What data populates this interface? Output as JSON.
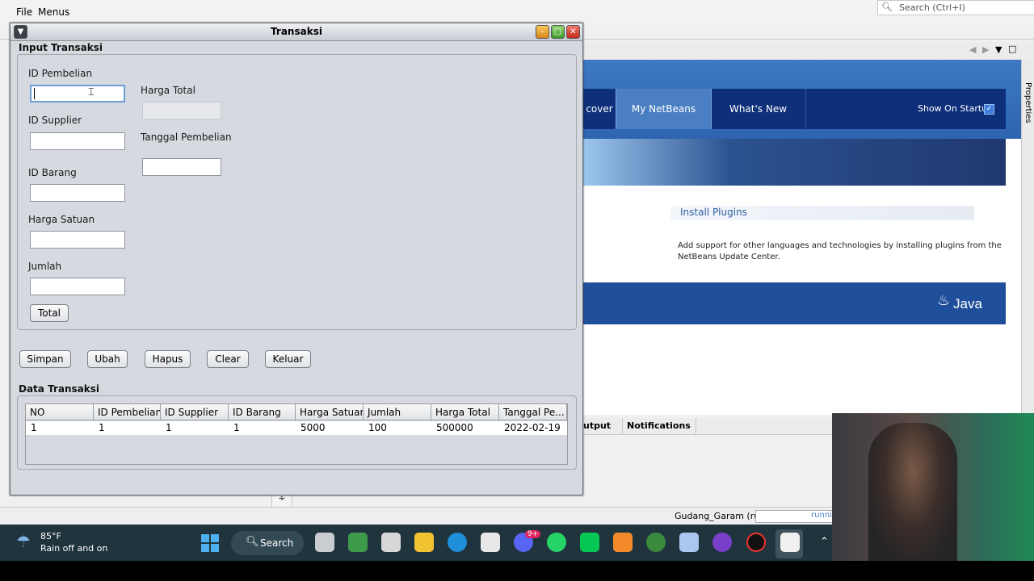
{
  "ide": {
    "menu": [
      "File",
      "Menus"
    ],
    "search_placeholder": "Search (Ctrl+I)",
    "status_text": "Gudang_Garam (run)",
    "status_progress": "runni",
    "side_tab": "Properties"
  },
  "start_page": {
    "tabs": [
      "cover",
      "My NetBeans",
      "What's New"
    ],
    "active_tab": "My NetBeans",
    "show_on_startup": "Show On Startup",
    "install_title": "Install Plugins",
    "install_desc_1": "Add support for other languages and technologies by installing plugins from the",
    "install_desc_2": "NetBeans Update Center.",
    "brand": "Java"
  },
  "output_panel": {
    "tabs": [
      "utput",
      "Notifications"
    ]
  },
  "dialog": {
    "title": "Transaksi",
    "input_section": "Input Transaksi",
    "fields": {
      "id_pembelian": {
        "label": "ID Pembelian",
        "value": ""
      },
      "id_supplier": {
        "label": "ID Supplier",
        "value": ""
      },
      "id_barang": {
        "label": "ID Barang",
        "value": ""
      },
      "harga_satuan": {
        "label": "Harga Satuan",
        "value": ""
      },
      "jumlah": {
        "label": "Jumlah",
        "value": ""
      },
      "harga_total": {
        "label": "Harga Total",
        "value": ""
      },
      "tanggal_pembelian": {
        "label": "Tanggal Pembelian",
        "value": ""
      }
    },
    "total_button": "Total",
    "actions": [
      "Simpan",
      "Ubah",
      "Hapus",
      "Clear",
      "Keluar"
    ],
    "data_section": "Data Transaksi",
    "table": {
      "columns": [
        "NO",
        "ID Pembelian",
        "ID Supplier",
        "ID Barang",
        "Harga Satuan",
        "Jumlah",
        "Harga Total",
        "Tanggal Pe..."
      ],
      "rows": [
        [
          "1",
          "1",
          "1",
          "1",
          "5000",
          "100",
          "500000",
          "2022-02-19"
        ]
      ]
    }
  },
  "taskbar": {
    "weather_temp": "85°F",
    "weather_desc": "Rain off and on",
    "search_label": "Search",
    "badge": "9+"
  },
  "colors": {
    "netbeans_nav": "#0e2f7a",
    "netbeans_active_tab": "#4a7fc3",
    "dialog_bg": "#d6d9df",
    "taskbar": "#20343e"
  }
}
